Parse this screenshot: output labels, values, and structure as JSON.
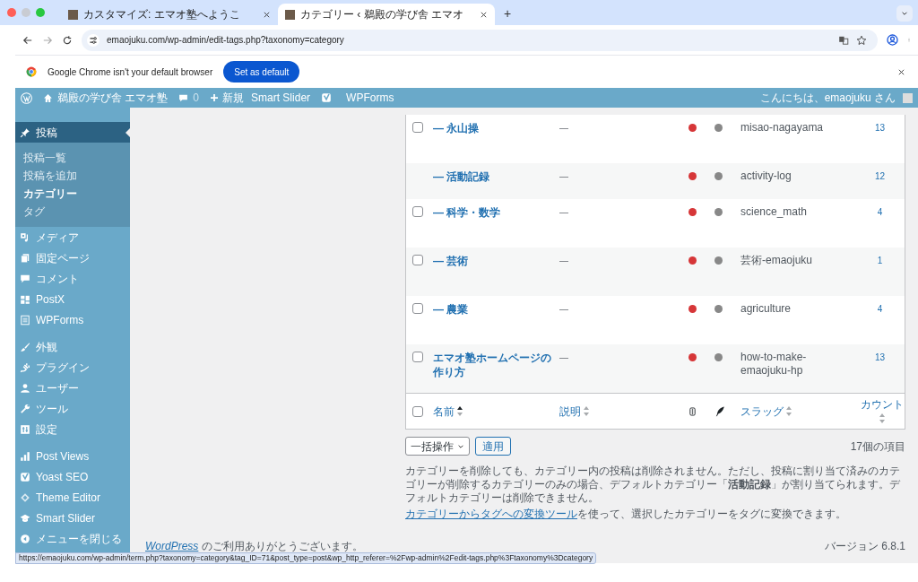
{
  "browser": {
    "tabs": [
      {
        "title": "カスタマイズ: エマオ塾へようこ",
        "selected": false
      },
      {
        "title": "カテゴリー ‹ 鵜殿の学び舎 エマオ",
        "selected": true
      }
    ],
    "new_tab": "+",
    "url": "emaojuku.com/wp-admin/edit-tags.php?taxonomy=category",
    "infobar": {
      "message": "Google Chrome isn't your default browser",
      "button": "Set as default"
    }
  },
  "admin_bar": {
    "site_name": "鵜殿の学び舎 エマオ塾",
    "comments": "0",
    "new": "新規",
    "items": [
      "Smart Slider",
      "WPForms"
    ],
    "greeting": "こんにちは、emaojuku さん"
  },
  "sidebar": {
    "groups": [
      [
        {
          "label": "投稿",
          "selected": true,
          "children": [
            {
              "label": "投稿一覧",
              "selected": false
            },
            {
              "label": "投稿を追加",
              "selected": false
            },
            {
              "label": "カテゴリー",
              "selected": true
            },
            {
              "label": "タグ",
              "selected": false
            }
          ]
        },
        {
          "label": "メディア",
          "selected": false
        },
        {
          "label": "固定ページ",
          "selected": false
        },
        {
          "label": "コメント",
          "selected": false
        },
        {
          "label": "PostX",
          "selected": false
        },
        {
          "label": "WPForms",
          "selected": false
        }
      ],
      [
        {
          "label": "外観",
          "selected": false
        },
        {
          "label": "プラグイン",
          "selected": false
        },
        {
          "label": "ユーザー",
          "selected": false
        },
        {
          "label": "ツール",
          "selected": false
        },
        {
          "label": "設定",
          "selected": false
        }
      ],
      [
        {
          "label": "Post Views",
          "selected": false
        },
        {
          "label": "Yoast SEO",
          "selected": false
        },
        {
          "label": "Theme Editor",
          "selected": false
        },
        {
          "label": "Smart Slider",
          "selected": false
        },
        {
          "label": "メニューを閉じる",
          "selected": false
        }
      ]
    ]
  },
  "table": {
    "rows": [
      {
        "name": "— 永山操",
        "has_checkbox": true,
        "checked": false,
        "description": "—",
        "seo": {
          "color": "#d63638"
        },
        "readability": {
          "color": "#888888"
        },
        "slug": "misao-nagayama",
        "count": "13"
      },
      {
        "name": "— 活動記録",
        "has_checkbox": false,
        "description": "—",
        "seo": {
          "color": "#d63638"
        },
        "readability": {
          "color": "#888888"
        },
        "slug": "activity-log",
        "count": "12"
      },
      {
        "name": "— 科学・数学",
        "has_checkbox": true,
        "checked": false,
        "description": "—",
        "seo": {
          "color": "#d63638"
        },
        "readability": {
          "color": "#888888"
        },
        "slug": "science_math",
        "count": "4"
      },
      {
        "name": "— 芸術",
        "has_checkbox": true,
        "checked": false,
        "description": "—",
        "seo": {
          "color": "#d63638"
        },
        "readability": {
          "color": "#888888"
        },
        "slug": "芸術-emaojuku",
        "count": "1"
      },
      {
        "name": "— 農業",
        "has_checkbox": true,
        "checked": false,
        "description": "—",
        "seo": {
          "color": "#d63638"
        },
        "readability": {
          "color": "#888888"
        },
        "slug": "agriculture",
        "count": "4"
      },
      {
        "name": "エマオ塾ホームページの作り方",
        "has_checkbox": true,
        "checked": false,
        "description": "—",
        "seo": {
          "color": "#d63638"
        },
        "readability": {
          "color": "#888888"
        },
        "slug": "how-to-make-emaojuku-hp",
        "count": "13"
      }
    ],
    "footer": {
      "select_all_checked": false,
      "columns": [
        {
          "kind": "sortable",
          "label": "名前",
          "sorted": true
        },
        {
          "kind": "sortable",
          "label": "説明",
          "sorted": false
        },
        {
          "kind": "seo"
        },
        {
          "kind": "readability"
        },
        {
          "kind": "sortable",
          "label": "スラッグ",
          "sorted": false
        },
        {
          "kind": "sortable",
          "label": "カウント",
          "sorted": false
        }
      ]
    }
  },
  "bulk_action": {
    "select": "一括操作",
    "apply": "適用",
    "count": "17個の項目"
  },
  "notice": "カテゴリーを削除しても、カテゴリー内の投稿は削除されません。ただし、投稿に割り当て済みのカテゴリーが削除するカテゴリーのみの場合、デフォルトカテゴリー「**活動記録**」が割り当てられます。デフォルトカテゴリーは削除できません。",
  "converter": {
    "link": "カテゴリーからタグへの変換ツール",
    "text": "を使って、選択したカテゴリーをタグに変換できます。"
  },
  "footer": {
    "thanks_link": "WordPress",
    "thanks": " のご利用ありがとうございます。",
    "version": "バージョン 6.8.1"
  },
  "status_url": "https://emaojuku.com/wp-admin/term.php?taxonomy=category&tag_ID=71&post_type=post&wp_http_referer=%2Fwp-admin%2Fedit-tags.php%3Ftaxonomy%3Dcategory"
}
